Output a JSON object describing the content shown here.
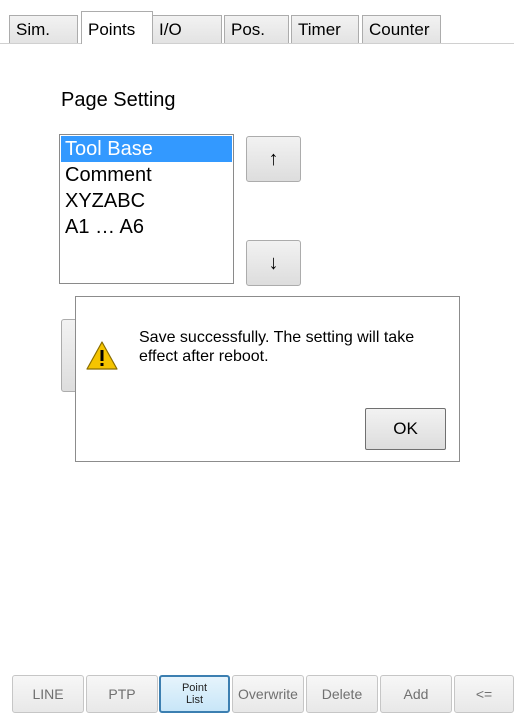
{
  "tabs": [
    {
      "label": "Sim.",
      "active": false
    },
    {
      "label": "Points",
      "active": true
    },
    {
      "label": "I/O",
      "active": false
    },
    {
      "label": "Pos.",
      "active": false
    },
    {
      "label": "Timer",
      "active": false
    },
    {
      "label": "Counter",
      "active": false
    }
  ],
  "page_setting": {
    "title": "Page Setting",
    "items": [
      "Tool Base",
      "Comment",
      "XYZABC",
      "A1 … A6"
    ],
    "selected": "Tool Base",
    "up_label": "↑",
    "down_label": "↓"
  },
  "dialog": {
    "icon": "warning-icon",
    "message": "Save successfully. The setting will take effect after reboot.",
    "ok_label": "OK"
  },
  "toolbar": {
    "line_label": "LINE",
    "ptp_label": "PTP",
    "point_list_line1": "Point",
    "point_list_line2": "List",
    "overwrite_label": "Overwrite",
    "delete_label": "Delete",
    "add_label": "Add",
    "back_label": "<="
  },
  "colors": {
    "selection": "#3399ff",
    "active_button_border": "#3c7fb1",
    "warning": "#f5c400"
  }
}
